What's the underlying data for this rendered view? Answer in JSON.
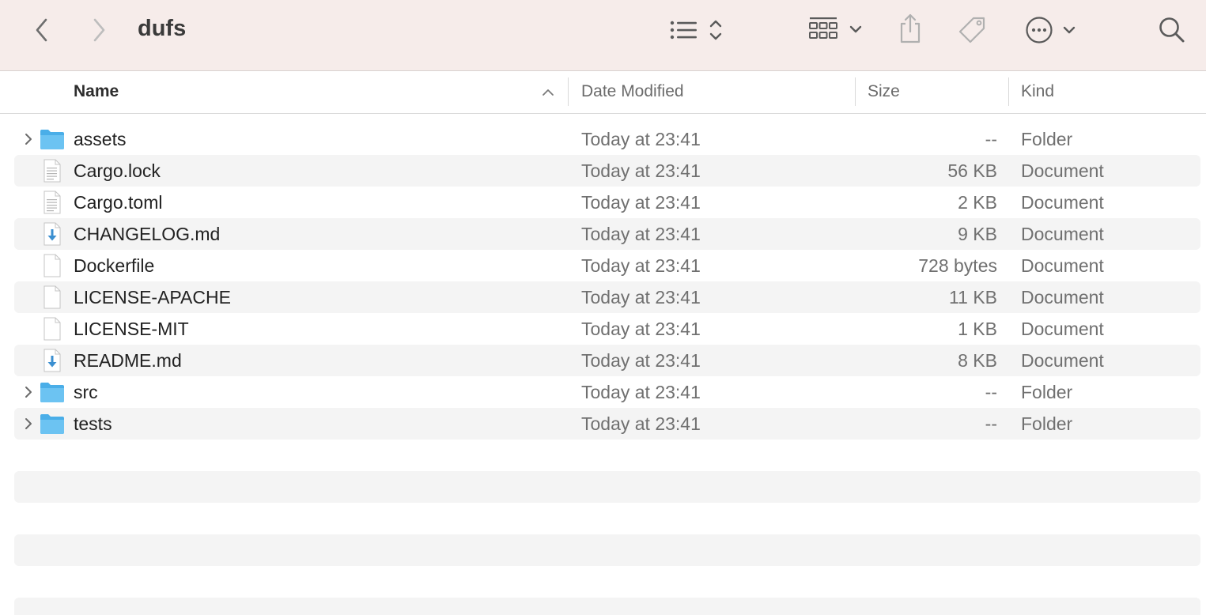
{
  "toolbar": {
    "title": "dufs",
    "icons": [
      "chevron-left-icon",
      "chevron-right-icon",
      "list-view-icon",
      "sort-updown-icon",
      "grid-view-icon",
      "chevron-down-icon",
      "share-icon",
      "tag-icon",
      "more-icon",
      "chevron-down-icon",
      "search-icon"
    ]
  },
  "columns": {
    "name": "Name",
    "date": "Date Modified",
    "size": "Size",
    "kind": "Kind"
  },
  "rows": [
    {
      "name": "assets",
      "date": "Today at 23:41",
      "size": "--",
      "kind": "Folder",
      "icon": "folder-icon",
      "expandable": true
    },
    {
      "name": "Cargo.lock",
      "date": "Today at 23:41",
      "size": "56 KB",
      "kind": "Document",
      "icon": "text-document-icon",
      "expandable": false
    },
    {
      "name": "Cargo.toml",
      "date": "Today at 23:41",
      "size": "2 KB",
      "kind": "Document",
      "icon": "text-document-icon",
      "expandable": false
    },
    {
      "name": "CHANGELOG.md",
      "date": "Today at 23:41",
      "size": "9 KB",
      "kind": "Document",
      "icon": "markdown-document-icon",
      "expandable": false
    },
    {
      "name": "Dockerfile",
      "date": "Today at 23:41",
      "size": "728 bytes",
      "kind": "Document",
      "icon": "blank-document-icon",
      "expandable": false
    },
    {
      "name": "LICENSE-APACHE",
      "date": "Today at 23:41",
      "size": "11 KB",
      "kind": "Document",
      "icon": "blank-document-icon",
      "expandable": false
    },
    {
      "name": "LICENSE-MIT",
      "date": "Today at 23:41",
      "size": "1 KB",
      "kind": "Document",
      "icon": "blank-document-icon",
      "expandable": false
    },
    {
      "name": "README.md",
      "date": "Today at 23:41",
      "size": "8 KB",
      "kind": "Document",
      "icon": "markdown-document-icon",
      "expandable": false
    },
    {
      "name": "src",
      "date": "Today at 23:41",
      "size": "--",
      "kind": "Folder",
      "icon": "folder-icon",
      "expandable": true
    },
    {
      "name": "tests",
      "date": "Today at 23:41",
      "size": "--",
      "kind": "Folder",
      "icon": "folder-icon",
      "expandable": true
    }
  ],
  "colors": {
    "toolbar_bg": "#f6ecea",
    "stripe": "#f4f4f4",
    "folder_blue": "#5ab8ee",
    "markdown_blue": "#3b8fd0"
  }
}
